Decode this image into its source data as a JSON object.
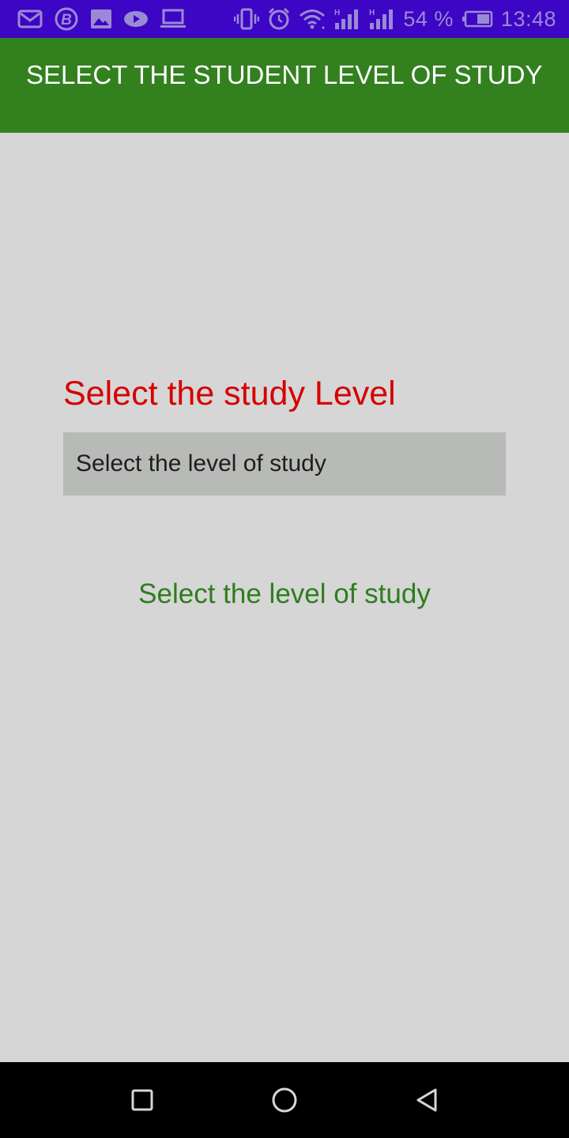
{
  "status_bar": {
    "battery": "54 %",
    "time": "13:48",
    "left_icons": [
      "gmail-icon",
      "b-app-icon",
      "image-icon",
      "video-icon",
      "laptop-icon"
    ],
    "right_icons": [
      "vibrate-icon",
      "alarm-icon",
      "wifi-icon",
      "signal-h-icon",
      "signal-h2-icon",
      "battery-icon"
    ],
    "color": "#3d05c4"
  },
  "app_bar": {
    "title": "SELECT THE STUDENT LEVEL OF STUDY",
    "color": "#33801f"
  },
  "main": {
    "label": "Select the study Level",
    "label_color": "#d60000",
    "spinner": {
      "selected": "Select the level of study"
    },
    "result": "Select the level of study",
    "result_color": "#2e7d1e"
  },
  "nav_bar": {
    "buttons": [
      "recents-icon",
      "home-icon",
      "back-icon"
    ]
  }
}
